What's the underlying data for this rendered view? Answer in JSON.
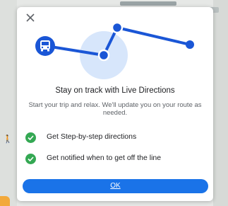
{
  "dialog": {
    "title": "Stay on track with Live Directions",
    "description": "Start your trip and relax. We'll update you on your route as needed.",
    "features": [
      {
        "icon": "check-circle-icon",
        "text": "Get Step-by-step directions"
      },
      {
        "icon": "check-circle-icon",
        "text": "Get notified when to get off the line"
      }
    ],
    "ok_label": "OK",
    "close_icon": "close-icon",
    "illustration_icon": "bus-icon"
  },
  "colors": {
    "accent": "#1a73e8",
    "route": "#1a56d6",
    "check": "#34a853",
    "halo": "#d7e6fb"
  }
}
